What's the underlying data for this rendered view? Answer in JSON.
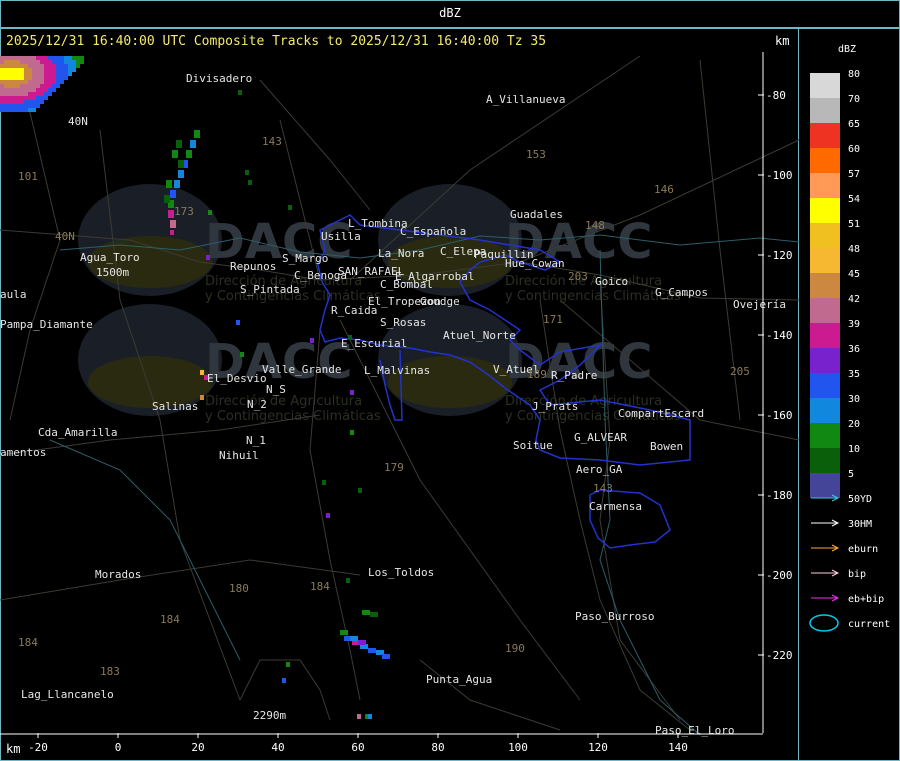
{
  "header": {
    "title": "dBZ"
  },
  "map": {
    "title": "2025/12/31 16:40:00 UTC Composite Tracks to 2025/12/31 16:40:00 Tz 35",
    "unit_top": "km",
    "unit_bottom": "km",
    "x_ticks": [
      "-20",
      "0",
      "20",
      "40",
      "60",
      "80",
      "100",
      "120",
      "140"
    ],
    "y_ticks": [
      "-80",
      "-100",
      "-120",
      "-140",
      "-160",
      "-180",
      "-200",
      "-220"
    ],
    "places": [
      "Divisadero",
      "A_Villanueva",
      "Guadales",
      "L_Tombina",
      "C_Española",
      "Usilla",
      "C_Elepa",
      "Paquillin",
      "La_Nora",
      "Hue_Cowan",
      "Goico",
      "G_Campos",
      "Ovejería",
      "Agua_Toro",
      "C_Benoga",
      "SAN_RAFAEL",
      "E_Algarrobal",
      "Repunos",
      "S_Margo",
      "S_Pintada",
      "C_Bombal",
      "El_Tropezon",
      "Goudge",
      "R_Caida",
      "S_Rosas",
      "Atuel_Norte",
      "E_Escurial",
      "Pampa_Diamante",
      "Valle_Grande",
      "L_Malvinas",
      "V_Atuel",
      "R_Padre",
      "El_Desvio",
      "N_S",
      "N_2",
      "Salinas",
      "J_Prats",
      "CompartEscard",
      "Cda_Amarilla",
      "N_1",
      "Soitue",
      "G_ALVEAR",
      "Bowen",
      "Nihuil",
      "Aero_GA",
      "Carmensa",
      "Morados",
      "Los_Toldos",
      "Paso_Burroso",
      "Punta_Agua",
      "Lag_Llancanelo",
      "2290m",
      "Paso_El_Loro",
      "amentos",
      "aula",
      "1500m",
      "40N"
    ],
    "road_numbers": [
      "143",
      "153",
      "146",
      "148",
      "101",
      "40N",
      "173",
      "180",
      "203",
      "171",
      "205",
      "184",
      "179",
      "190",
      "183",
      "143",
      "184",
      "189",
      "184"
    ],
    "watermark": {
      "brand": "DACC",
      "line1": "Dirección de Agricultura",
      "line2": "y Contingencias Climáticas"
    }
  },
  "legend": {
    "title": "dBZ",
    "scale": [
      {
        "label": "80",
        "color": "#d8d8d8"
      },
      {
        "label": "70",
        "color": "#b8b8b8"
      },
      {
        "label": "65",
        "color": "#ee3322"
      },
      {
        "label": "60",
        "color": "#ff6a00"
      },
      {
        "label": "57",
        "color": "#ff9955"
      },
      {
        "label": "54",
        "color": "#ffff00"
      },
      {
        "label": "51",
        "color": "#f0c020"
      },
      {
        "label": "48",
        "color": "#f5b830"
      },
      {
        "label": "45",
        "color": "#cc8840"
      },
      {
        "label": "42",
        "color": "#c06a90"
      },
      {
        "label": "39",
        "color": "#cc1a90"
      },
      {
        "label": "36",
        "color": "#7722cc"
      },
      {
        "label": "35",
        "color": "#2255ee"
      },
      {
        "label": "30",
        "color": "#1188dd"
      },
      {
        "label": "20",
        "color": "#118811"
      },
      {
        "label": "10",
        "color": "#0a600a"
      },
      {
        "label": "5",
        "color": "#444499"
      }
    ],
    "tracks": [
      {
        "label": "50YD",
        "color": "#33ccdd"
      },
      {
        "label": "30HM",
        "color": "#ffffff"
      },
      {
        "label": "eburn",
        "color": "#ffaa33"
      },
      {
        "label": "bip",
        "color": "#ffccdd"
      },
      {
        "label": "eb+bip",
        "color": "#ee33ee"
      },
      {
        "label": "current",
        "color": "#00ccee"
      }
    ]
  }
}
